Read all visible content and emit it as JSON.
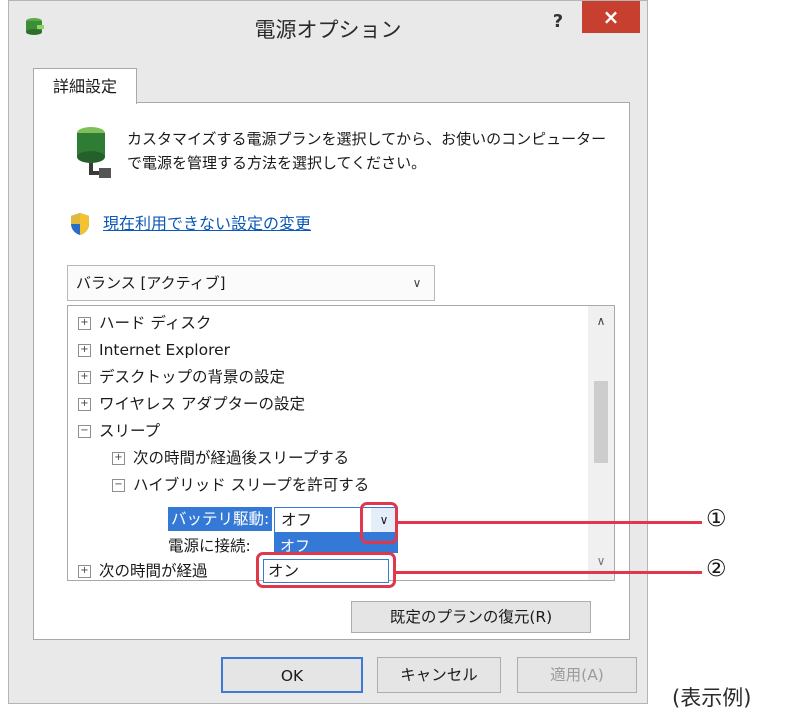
{
  "window": {
    "title": "電源オプション",
    "help": "?",
    "close": "×"
  },
  "tab": {
    "label": "詳細設定"
  },
  "description": {
    "line1": "カスタマイズする電源プランを選択してから、お使いのコンピューター",
    "line2": "で電源を管理する方法を選択してください。"
  },
  "link": {
    "label": "現在利用できない設定の変更"
  },
  "plan_select": {
    "value": "バランス [アクティブ]"
  },
  "tree": {
    "items": [
      {
        "expander": "⊞",
        "label": "ハード ディスク"
      },
      {
        "expander": "⊞",
        "label": "Internet Explorer"
      },
      {
        "expander": "⊞",
        "label": "デスクトップの背景の設定"
      },
      {
        "expander": "⊞",
        "label": "ワイヤレス アダプターの設定"
      },
      {
        "expander": "⊟",
        "label": "スリープ"
      },
      {
        "expander": "⊞",
        "label": "次の時間が経過後スリープする"
      },
      {
        "expander": "⊟",
        "label": "ハイブリッド スリープを許可する"
      }
    ],
    "battery_label": "バッテリ駆動:",
    "battery_value": "オフ",
    "ac_label": "電源に接続:",
    "ac_value_partial": "オフ",
    "next_partial": "次の時間が経過"
  },
  "dropdown_option": "オン",
  "buttons": {
    "restore": "既定のプランの復元(R)",
    "ok": "OK",
    "cancel": "キャンセル",
    "apply": "適用(A)"
  },
  "callouts": {
    "one": "①",
    "two": "②"
  },
  "caption": "(表示例)",
  "colors": {
    "close_red": "#c7402f",
    "select_blue": "#3479d6",
    "callout_red": "#e0374d",
    "link_blue": "#0b58b8"
  }
}
